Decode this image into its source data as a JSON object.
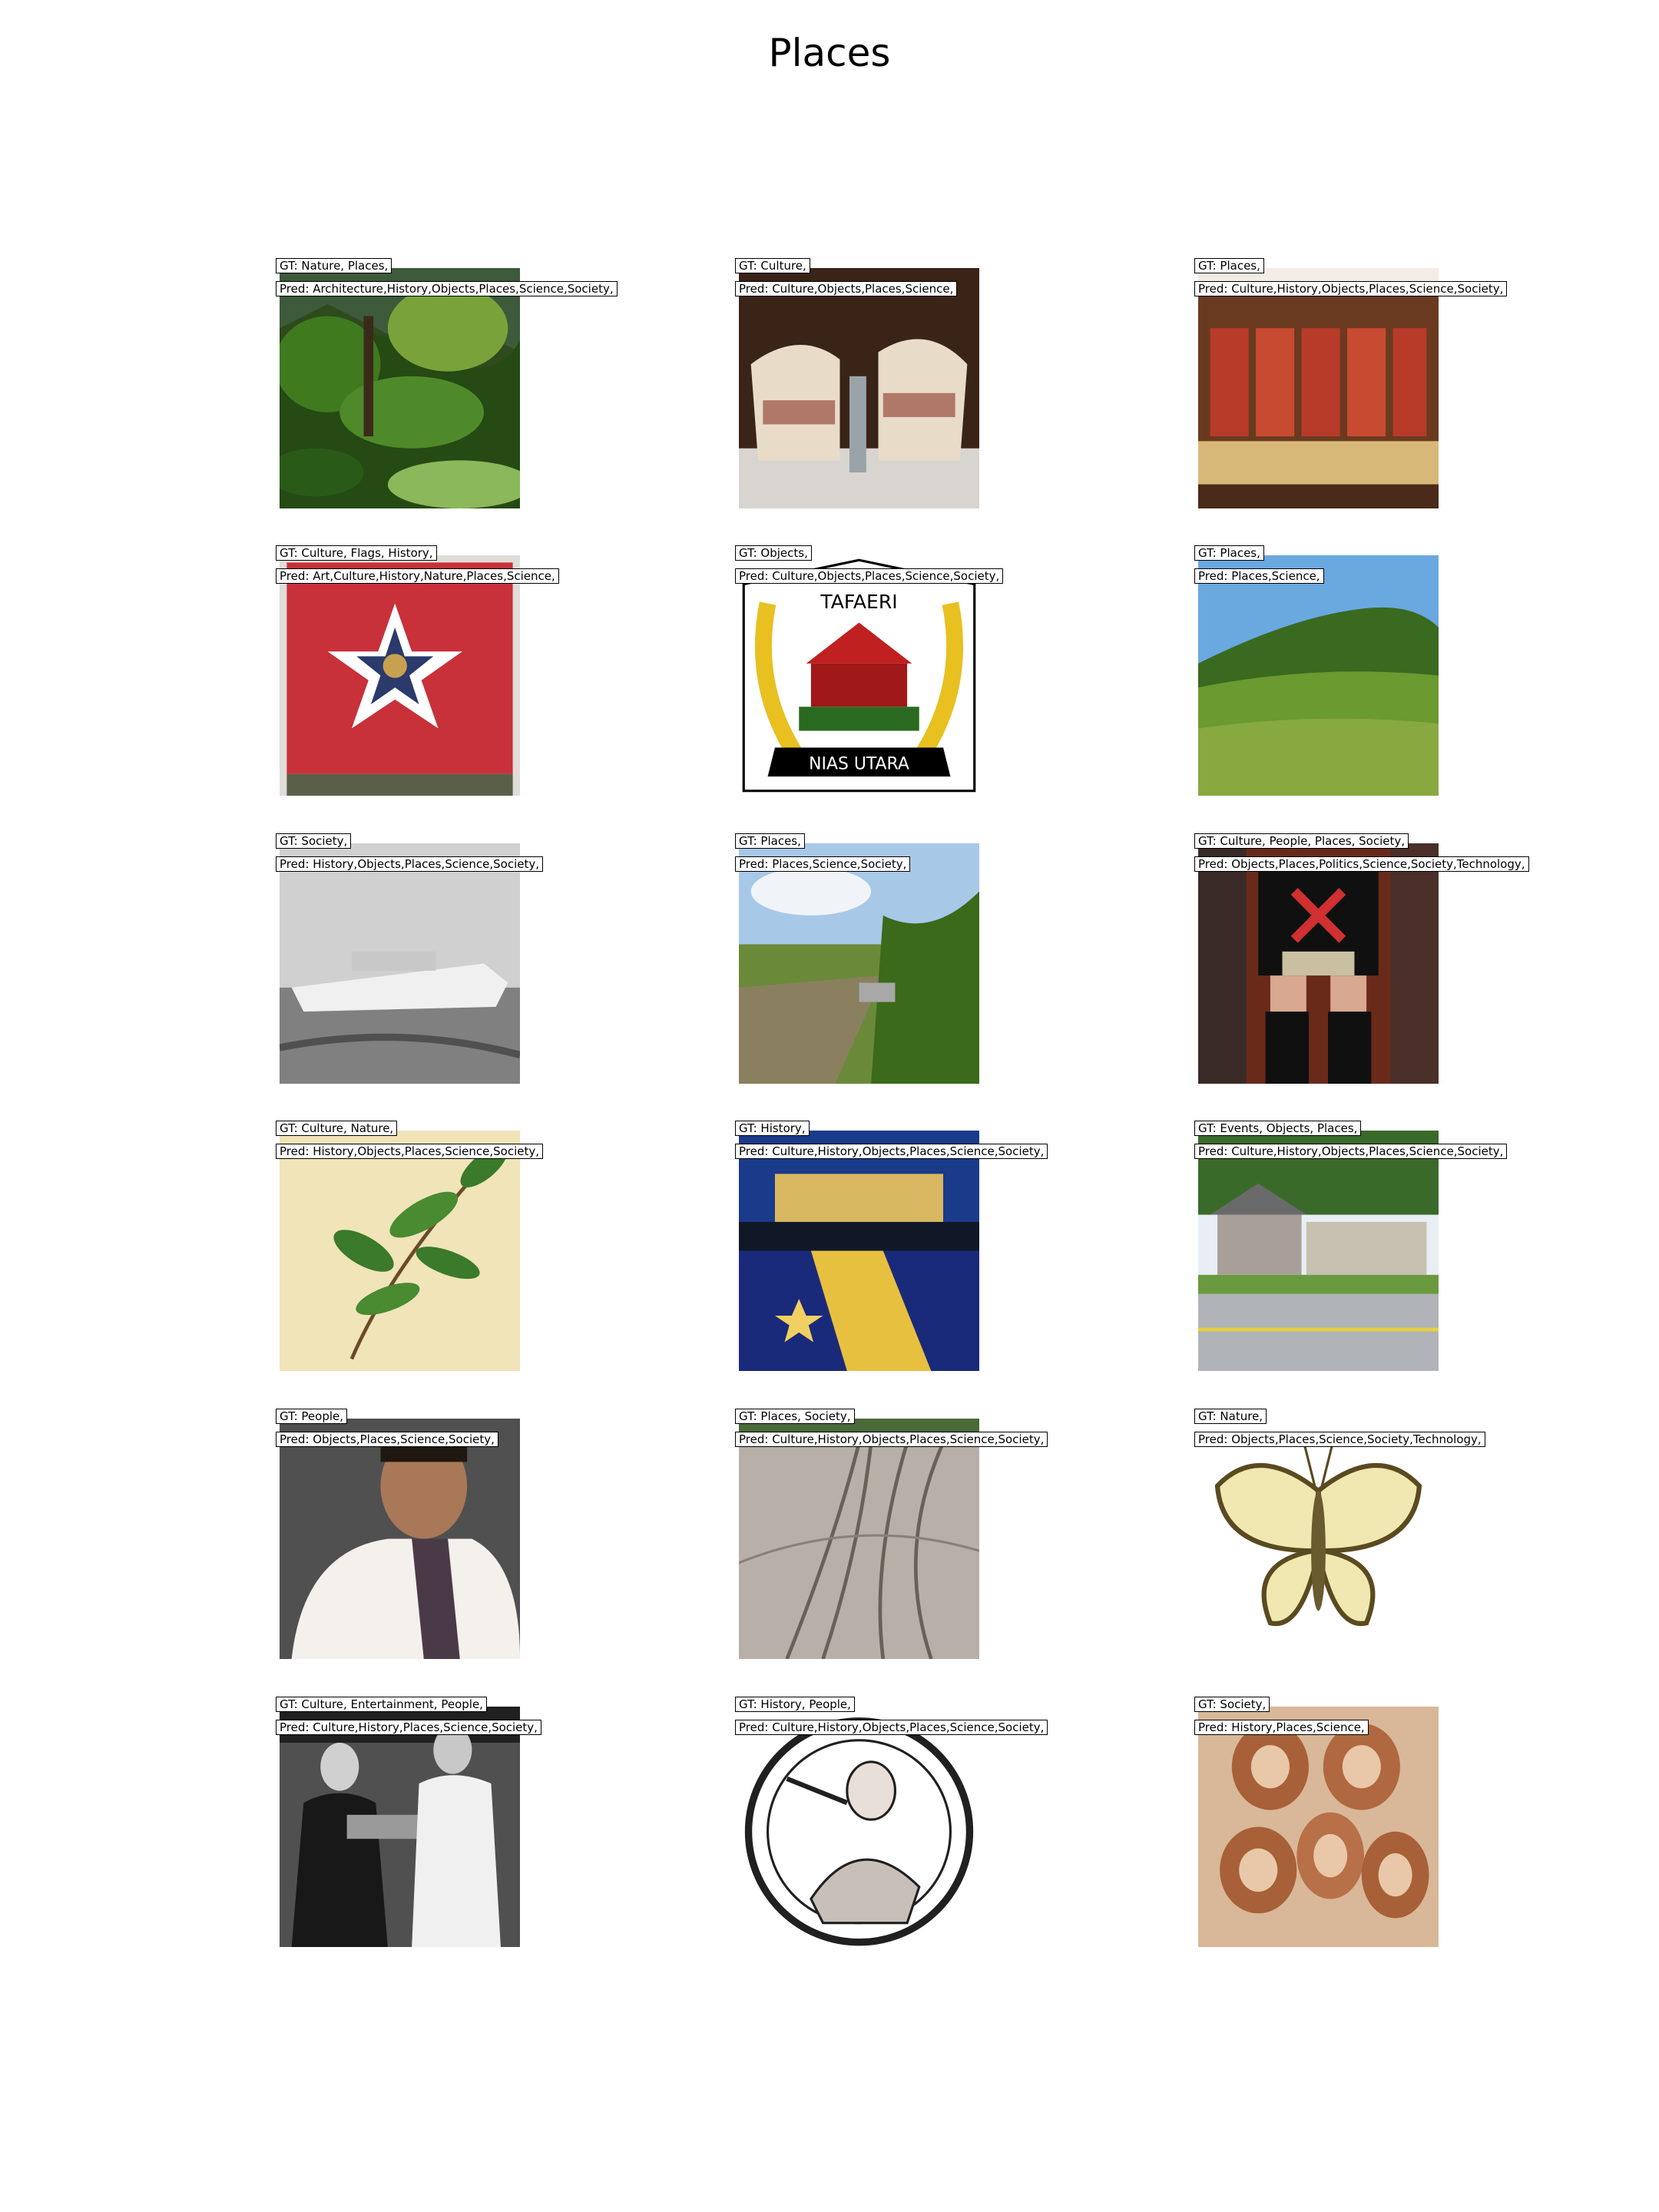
{
  "title": "Places",
  "grid": [
    {
      "gt": "GT: Nature, Places,",
      "pred": "Pred: Architecture,History,Objects,Places,Science,Society,",
      "image": "tropical-garden"
    },
    {
      "gt": "GT: Culture,",
      "pred": "Pred: Culture,Objects,Places,Science,",
      "image": "sandwich"
    },
    {
      "gt": "GT: Places,",
      "pred": "Pred: Culture,History,Objects,Places,Science,Society,",
      "image": "painted-screen"
    },
    {
      "gt": "GT: Culture, Flags, History,",
      "pred": "Pred: Art,Culture,History,Nature,Places,Science,",
      "image": "red-flag"
    },
    {
      "gt": "GT: Objects,",
      "pred": "Pred: Culture,Objects,Places,Science,Society,",
      "image": "nias-utara-emblem",
      "emblem_top": "TAFAERI",
      "emblem_banner": "NIAS UTARA"
    },
    {
      "gt": "GT: Places,",
      "pred": "Pred: Places,Science,",
      "image": "green-hills"
    },
    {
      "gt": "GT: Society,",
      "pred": "Pred: History,Objects,Places,Science,Society,",
      "image": "boat-photo"
    },
    {
      "gt": "GT: Places,",
      "pred": "Pred: Places,Science,Society,",
      "image": "field-path"
    },
    {
      "gt": "GT: Culture, People, Places, Society,",
      "pred": "Pred: Objects,Places,Politics,Science,Society,Technology,",
      "image": "wrestler"
    },
    {
      "gt": "GT: Culture, Nature,",
      "pred": "Pred: History,Objects,Places,Science,Society,",
      "image": "botanical-plant"
    },
    {
      "gt": "GT: History,",
      "pred": "Pred: Culture,History,Objects,Places,Science,Society,",
      "image": "candle-flag-night"
    },
    {
      "gt": "GT: Events, Objects, Places,",
      "pred": "Pred: Culture,History,Objects,Places,Science,Society,",
      "image": "street-building"
    },
    {
      "gt": "GT: People,",
      "pred": "Pred: Objects,Places,Science,Society,",
      "image": "man-portrait"
    },
    {
      "gt": "GT: Places, Society,",
      "pred": "Pred: Culture,History,Objects,Places,Science,Society,",
      "image": "tram-tracks"
    },
    {
      "gt": "GT: Nature,",
      "pred": "Pred: Objects,Places,Science,Society,Technology,",
      "image": "butterfly"
    },
    {
      "gt": "GT: Culture, Entertainment, People,",
      "pred": "Pred: Culture,History,Places,Science,Society,",
      "image": "award-ceremony"
    },
    {
      "gt": "GT: History, People,",
      "pred": "Pred: Culture,History,Objects,Places,Science,Society,",
      "image": "engraved-medallion"
    },
    {
      "gt": "GT: Society,",
      "pred": "Pred: History,Places,Science,",
      "image": "virus-micrograph"
    }
  ]
}
